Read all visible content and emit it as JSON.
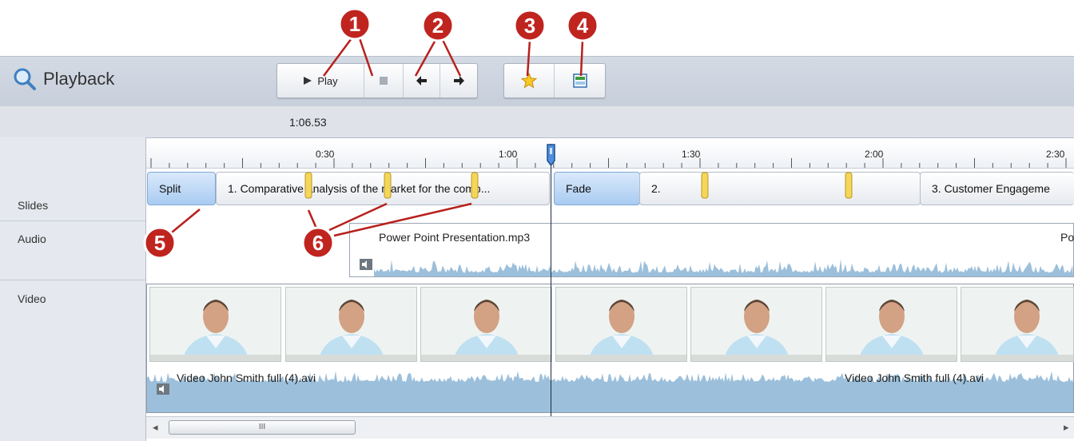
{
  "panel": {
    "title": "Playback",
    "timecode": "1:06.53"
  },
  "toolbar": {
    "play_label": "Play",
    "play_icon": "play-icon",
    "stop_icon": "stop-icon",
    "prev_icon": "arrow-left-icon",
    "next_icon": "arrow-right-icon",
    "star_icon": "star-icon",
    "layout_icon": "layout-icon"
  },
  "callouts": [
    "1",
    "2",
    "3",
    "4",
    "5",
    "6"
  ],
  "ruler": {
    "ticks": [
      "0:30",
      "1:00",
      "1:30",
      "2:00",
      "2:30"
    ]
  },
  "tracks": {
    "slides": "Slides",
    "audio": "Audio",
    "video": "Video"
  },
  "slides": [
    {
      "label": "Split",
      "kind": "transition"
    },
    {
      "label": "1. Comparative analysis of the market for the comp...",
      "kind": "slide"
    },
    {
      "label": "Fade",
      "kind": "transition"
    },
    {
      "label": "2.",
      "kind": "slide"
    },
    {
      "label": "3. Customer Engageme",
      "kind": "slide"
    }
  ],
  "audio": {
    "clip_name": "Power Point Presentation.mp3",
    "clip_name_cut": "Po"
  },
  "video": {
    "clip_name_1": "Video John Smith full (4).avi",
    "clip_name_2": "Video John Smith full (4).avi"
  },
  "scrollbar": {
    "thumb_glyph": "III",
    "left_arrow": "◂",
    "right_arrow": "▸"
  },
  "colors": {
    "callout_red": "#c0241f",
    "transition_blue": "#a9cbf1",
    "waveform": "#9cc0db",
    "marker_yellow": "#f5d65a"
  }
}
